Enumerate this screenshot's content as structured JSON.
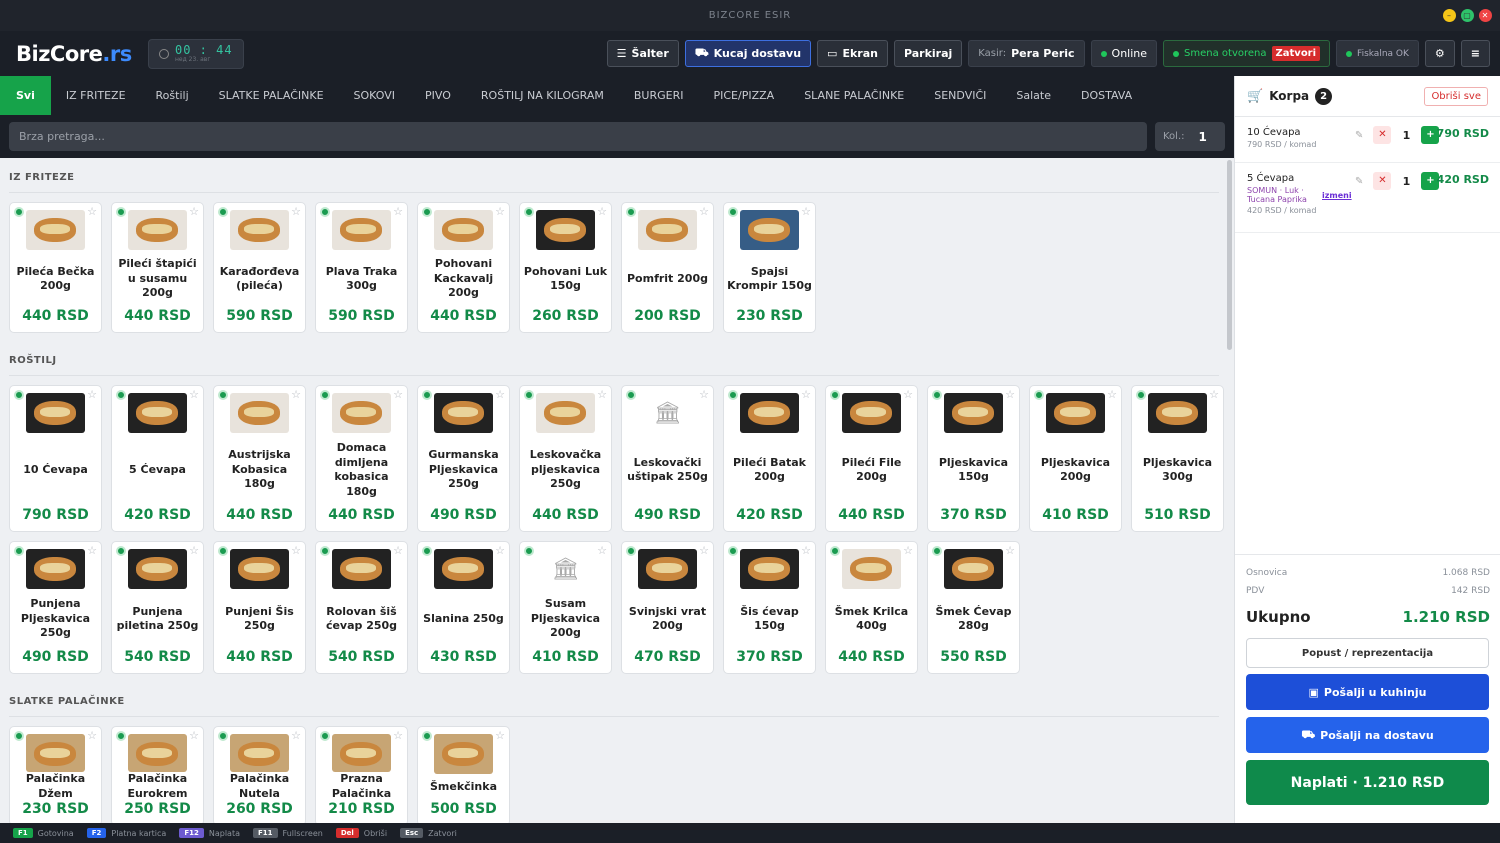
{
  "window": {
    "title": "BIZCORE ESIR"
  },
  "header": {
    "logo_main": "BizCore",
    "logo_suffix": ".rs",
    "clock": "00 : 44",
    "date": "нед 23. авг",
    "buttons": {
      "salter": "Šalter",
      "kucaj": "Kucaj dostavu",
      "ekran": "Ekran",
      "parkiraj": "Parkiraj"
    },
    "kasir_label": "Kasir:",
    "kasir_name": "Pera Peric",
    "online": "Online",
    "smena": "Smena otvorena",
    "zatvori": "Zatvori",
    "fiskalna": "Fiskalna OK"
  },
  "categories": [
    "Svi",
    "IZ FRITEZE",
    "Roštilj",
    "SLATKE PALAČINKE",
    "SOKOVI",
    "PIVO",
    "ROŠTILJ NA KILOGRAM",
    "BURGERI",
    "PICE/PIZZA",
    "SLANE PALAČINKE",
    "SENDVIČI",
    "Salate",
    "DOSTAVA"
  ],
  "search": {
    "placeholder": "Brza pretraga...",
    "kol_label": "Kol.:",
    "kol_value": "1"
  },
  "sections": {
    "friteze": {
      "title": "IZ FRITEZE",
      "items": [
        {
          "name": "Pileća Bečka 200g",
          "price": "440 RSD"
        },
        {
          "name": "Pileći štapići u susamu 200g",
          "price": "440 RSD"
        },
        {
          "name": "Karađorđeva (pileća)",
          "price": "590 RSD"
        },
        {
          "name": "Plava Traka 300g",
          "price": "590 RSD"
        },
        {
          "name": "Pohovani Kackavalj 200g",
          "price": "440 RSD"
        },
        {
          "name": "Pohovani Luk 150g",
          "price": "260 RSD"
        },
        {
          "name": "Pomfrit 200g",
          "price": "200 RSD"
        },
        {
          "name": "Spajsi Krompir 150g",
          "price": "230 RSD"
        }
      ]
    },
    "rostilj": {
      "title": "ROŠTILJ",
      "items": [
        {
          "name": "10 Ćevapa",
          "price": "790 RSD"
        },
        {
          "name": "5 Ćevapa",
          "price": "420 RSD"
        },
        {
          "name": "Austrijska Kobasica 180g",
          "price": "440 RSD"
        },
        {
          "name": "Domaca dimljena kobasica 180g",
          "price": "440 RSD"
        },
        {
          "name": "Gurmanska Pljeskavica 250g",
          "price": "490 RSD"
        },
        {
          "name": "Leskovačka pljeskavica 250g",
          "price": "440 RSD"
        },
        {
          "name": "Leskovački uštipak 250g",
          "price": "490 RSD"
        },
        {
          "name": "Pileći Batak 200g",
          "price": "420 RSD"
        },
        {
          "name": "Pileći File 200g",
          "price": "440 RSD"
        },
        {
          "name": "Pljeskavica 150g",
          "price": "370 RSD"
        },
        {
          "name": "Pljeskavica 200g",
          "price": "410 RSD"
        },
        {
          "name": "Pljeskavica 300g",
          "price": "510 RSD"
        },
        {
          "name": "Punjena Pljeskavica 250g",
          "price": "490 RSD"
        },
        {
          "name": "Punjena piletina 250g",
          "price": "540 RSD"
        },
        {
          "name": "Punjeni Šis 250g",
          "price": "440 RSD"
        },
        {
          "name": "Rolovan šiš ćevap 250g",
          "price": "540 RSD"
        },
        {
          "name": "Slanina 250g",
          "price": "430 RSD"
        },
        {
          "name": "Susam Pljeskavica 200g",
          "price": "410 RSD"
        },
        {
          "name": "Svinjski vrat 200g",
          "price": "470 RSD"
        },
        {
          "name": "Šis ćevap 150g",
          "price": "370 RSD"
        },
        {
          "name": "Šmek Krilca 400g",
          "price": "440 RSD"
        },
        {
          "name": "Šmek Ćevap 280g",
          "price": "550 RSD"
        }
      ]
    },
    "palacinke": {
      "title": "SLATKE PALAČINKE",
      "items": [
        {
          "name": "Palačinka Džem",
          "price": "230 RSD"
        },
        {
          "name": "Palačinka Eurokrem",
          "price": "250 RSD"
        },
        {
          "name": "Palačinka Nutela",
          "price": "260 RSD"
        },
        {
          "name": "Prazna Palačinka",
          "price": "210 RSD"
        },
        {
          "name": "Šmekčinka",
          "price": "500 RSD"
        }
      ]
    }
  },
  "cart": {
    "title": "Korpa",
    "count": "2",
    "clear": "Obriši sve",
    "items": [
      {
        "name": "10 Ćevapa",
        "unit": "790 RSD / komad",
        "qty": "1",
        "amount": "790 RSD",
        "mods": ""
      },
      {
        "name": "5 Ćevapa",
        "unit": "420 RSD / komad",
        "qty": "1",
        "amount": "420 RSD",
        "mods": "SOMUN · Luk · Tucana Paprika",
        "edit": "izmeni"
      }
    ],
    "osnovica_label": "Osnovica",
    "osnovica": "1.068 RSD",
    "pdv_label": "PDV",
    "pdv": "142 RSD",
    "total_label": "Ukupno",
    "total": "1.210 RSD",
    "popust": "Popust / reprezentacija",
    "kuhinja": "Pošalji u kuhinju",
    "dostava": "Pošalji na dostavu",
    "naplati": "Naplati · 1.210 RSD"
  },
  "shortcuts": [
    {
      "key": "F1",
      "label": "Gotovina",
      "color": "#16a34a"
    },
    {
      "key": "F2",
      "label": "Platna kartica",
      "color": "#2563eb"
    },
    {
      "key": "F12",
      "label": "Naplata",
      "color": "#6d5bd0"
    },
    {
      "key": "F11",
      "label": "Fullscreen",
      "color": "#555b64"
    },
    {
      "key": "Del",
      "label": "Obriši",
      "color": "#d62d2d"
    },
    {
      "key": "Esc",
      "label": "Zatvori",
      "color": "#555b64"
    }
  ]
}
